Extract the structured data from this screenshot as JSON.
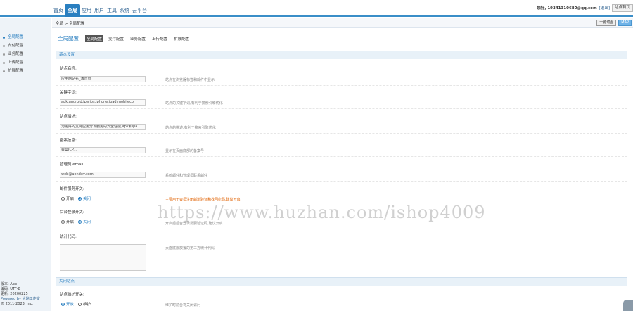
{
  "nav": {
    "items": [
      "首页",
      "全局",
      "应用",
      "用户",
      "工具",
      "系统",
      "云平台"
    ],
    "active": 1
  },
  "topright": {
    "email": "您好, 19341310680@qq.com",
    "profile": "[退出]",
    "back": "站点首页"
  },
  "crumb": "全局 > 全局配置",
  "crumb_buttons": {
    "clear": "一键切图",
    "map": "MAP"
  },
  "sidebar": {
    "items": [
      "全局配置",
      "支付配置",
      "业务配置",
      "上传配置",
      "扩展配置"
    ],
    "active": 0,
    "footer": [
      "版本: App",
      "编码: UTF-8",
      "更新: 20200225",
      "Powered by 大站工作室",
      "© 2011-2023, Inc."
    ]
  },
  "tabs": {
    "title": "全局配置",
    "items": [
      "全局配置",
      "支付配置",
      "业务配置",
      "上传配置",
      "扩展配置"
    ],
    "active": 0
  },
  "sections": {
    "basic": "基本设置",
    "close": "关闭站点"
  },
  "fields": {
    "site_name": {
      "label": "站点名称:",
      "value": "应用网站名_演示页",
      "hint": "站点在浏览器标签和邮件中显示"
    },
    "keywords": {
      "label": "关键字词:",
      "value": "apk,android,ipa,ios,iphone,ipad,mobileco",
      "hint": "站点的关键字词,有利于搜索引擎优化"
    },
    "description": {
      "label": "站点描述:",
      "value": "为更好的支持应用分发服务的安全性能,apk和ipa",
      "hint": "站点的描述,有利于搜索引擎优化"
    },
    "icp": {
      "label": "备案信息:",
      "value": "备案ICP...",
      "hint": "显示在页面底部的备案号"
    },
    "email": {
      "label": "管理员 email:",
      "value": "web@aendev.com",
      "hint": "系统邮件和管理员联系邮件"
    },
    "reg_switch": {
      "label": "邮件服务开关:",
      "options": [
        "开启",
        "关闭"
      ],
      "selected": 1,
      "hint": "主要用于会员注册邮箱验证和找回密码,建议开启"
    },
    "captcha_switch": {
      "label": "后台登录开关:",
      "options": [
        "开启",
        "关闭"
      ],
      "selected": 1,
      "hint": "开启后后台登录需要验证码,建议开启"
    },
    "stat_code": {
      "label": "统计代码:",
      "hint": "页面底部放置的第三方统计代码"
    },
    "maintenance": {
      "label": "站点维护开关:",
      "options": [
        "开放",
        "维护"
      ],
      "selected": 0,
      "hint": "维护时前台将关闭访问"
    }
  },
  "watermark": "https://www.huzhan.com/ishop4009"
}
